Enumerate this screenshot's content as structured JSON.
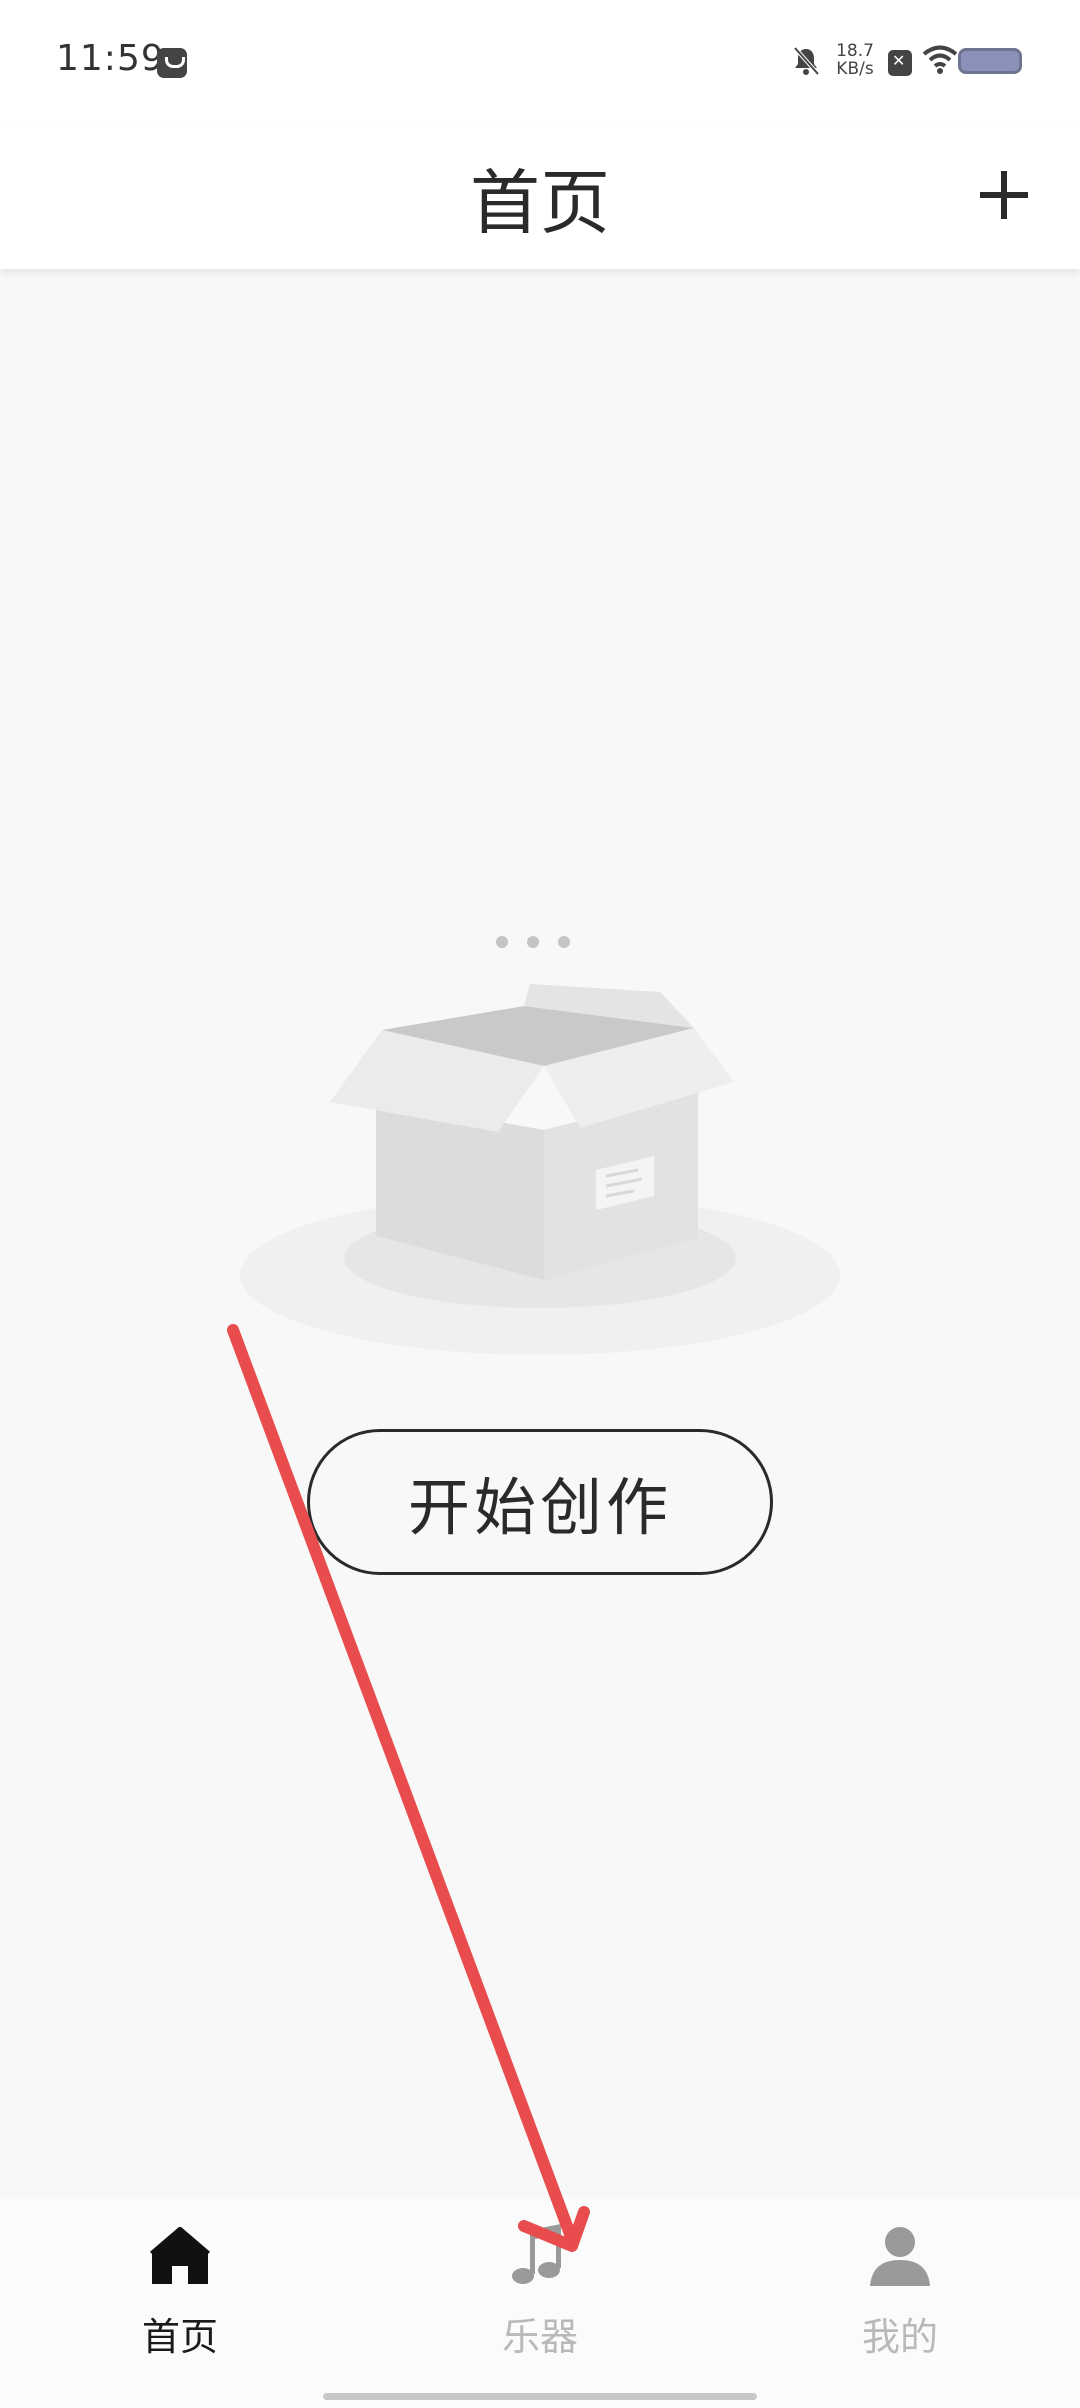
{
  "status_bar": {
    "time": "11:59",
    "net_speed_value": "18.7",
    "net_speed_unit": "KB/s",
    "icons": [
      "notification-app-icon",
      "mute-bell-icon",
      "sim-off-icon",
      "wifi-icon",
      "battery-icon"
    ]
  },
  "header": {
    "title": "首页",
    "add_icon": "plus-icon"
  },
  "empty_state": {
    "illustration": "empty-box-illustration",
    "button_label": "开始创作"
  },
  "bottom_nav": {
    "items": [
      {
        "label": "首页",
        "icon": "home-icon",
        "active": true
      },
      {
        "label": "乐器",
        "icon": "music-note-icon",
        "active": false
      },
      {
        "label": "我的",
        "icon": "person-icon",
        "active": false
      }
    ]
  },
  "colors": {
    "active_text": "#1a1a1a",
    "inactive_text": "#b9b9b9",
    "annotation_arrow": "#e84c4c",
    "background": "#f8f8f8"
  }
}
